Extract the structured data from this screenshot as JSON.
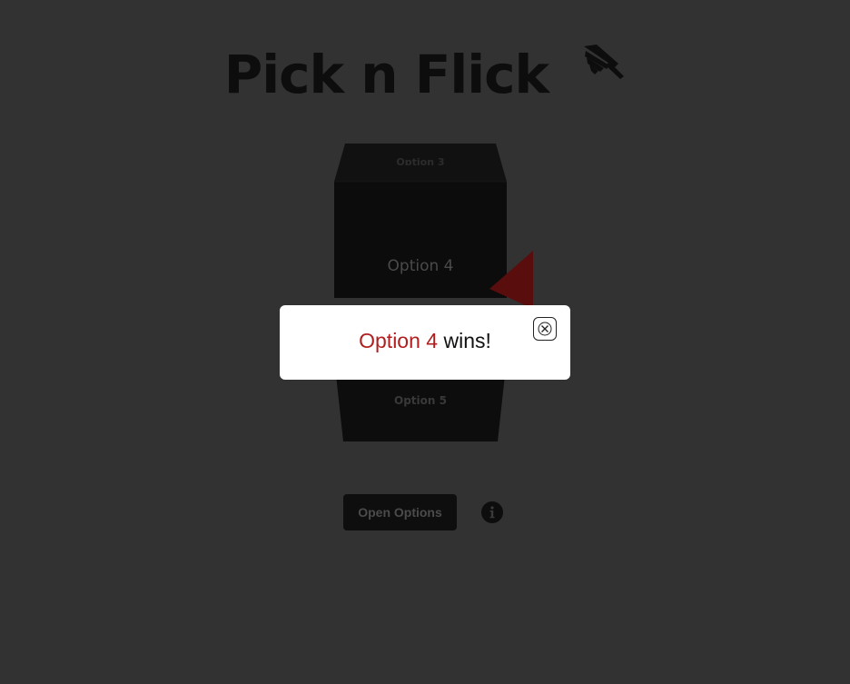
{
  "header": {
    "title": "Pick n Flick",
    "title_icon": "pointing-hand-icon"
  },
  "wheel": {
    "top_option": "Option 3",
    "main_option": "Option 4",
    "bottom_option": "Option 5",
    "pointer_icon": "triangle-pointer-icon"
  },
  "result_dialog": {
    "winner": "Option 4",
    "suffix": " wins!",
    "close_icon": "close-icon"
  },
  "controls": {
    "open_options_label": "Open Options",
    "info_icon": "info-icon"
  },
  "colors": {
    "background": "#323232",
    "accent_red": "#b01f1f",
    "pointer_red": "#5a0d0d"
  }
}
